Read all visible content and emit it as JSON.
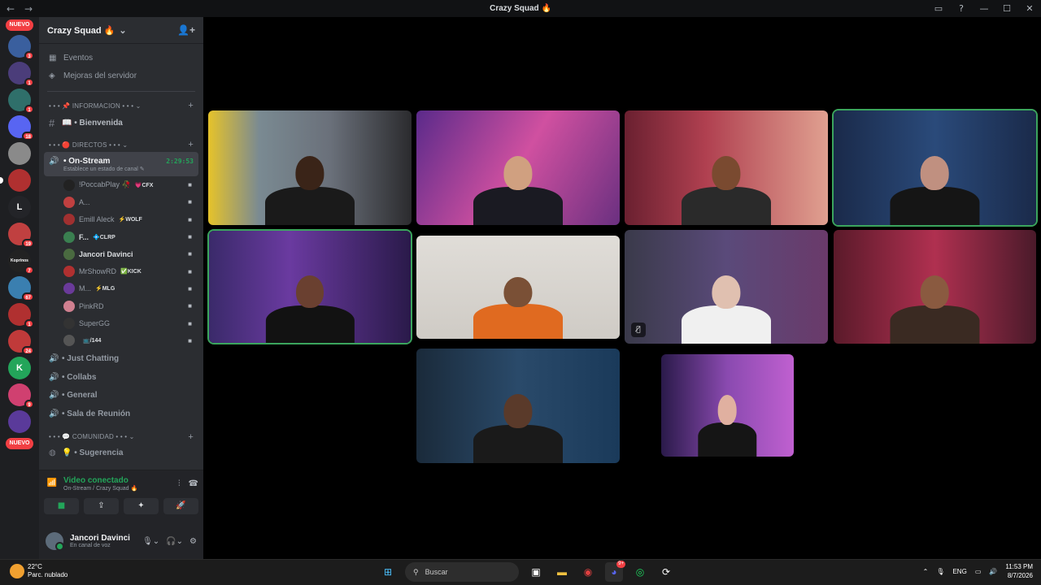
{
  "window": {
    "title": "Crazy Squad 🔥",
    "back": "←",
    "forward": "→",
    "inbox": "▭",
    "help": "?",
    "minimize": "—",
    "maximize": "☐",
    "close": "✕"
  },
  "guilds": {
    "new_label": "NUEVO",
    "items": [
      {
        "name": "guild-1",
        "badge": "3",
        "color": "#3a5f9e"
      },
      {
        "name": "guild-2",
        "badge": "1",
        "color": "#4b3d7a"
      },
      {
        "name": "guild-3",
        "badge": "1",
        "color": "#2f6f6a"
      },
      {
        "name": "guild-4",
        "badge": "18",
        "color": "#5865f2"
      },
      {
        "name": "guild-5",
        "badge": "",
        "color": "#8a8a8a"
      },
      {
        "name": "guild-6",
        "badge": "",
        "color": "#b03030"
      },
      {
        "name": "guild-7",
        "badge": "",
        "color": "#232428",
        "text": "L"
      },
      {
        "name": "guild-8",
        "badge": "19",
        "color": "#c04040"
      },
      {
        "name": "guild-9",
        "badge": "7",
        "color": "#222",
        "text": "Koprinos"
      },
      {
        "name": "guild-10",
        "badge": "67",
        "color": "#3a7fb0"
      },
      {
        "name": "guild-11",
        "badge": "1",
        "color": "#b03030"
      },
      {
        "name": "guild-12",
        "badge": "24",
        "color": "#c03a3a"
      },
      {
        "name": "guild-13",
        "badge": "",
        "color": "#23a55a",
        "text": "K"
      },
      {
        "name": "guild-14",
        "badge": "9",
        "color": "#d04070"
      },
      {
        "name": "guild-15",
        "badge": "",
        "color": "#5a3a9a"
      }
    ]
  },
  "server": {
    "name": "Crazy Squad 🔥",
    "events": "Eventos",
    "boosts": "Mejoras del servidor",
    "cat_info": "• • • 📌 INFORMACION • • • ⌄",
    "welcome": "📖 • Bienvenida",
    "cat_direct": "• • • 🔴 DIRECTOS • • • ⌄",
    "active_channel": "• On-Stream",
    "active_time": "2:29:53",
    "active_status": "Establece un estado de canal ✎",
    "users": [
      {
        "name": "!PoccabPlay 🥀",
        "tag": "💗CFX",
        "color": "#222",
        "bright": false
      },
      {
        "name": "A...",
        "tag": "",
        "color": "#c04040",
        "bright": false
      },
      {
        "name": "Emill Aleck",
        "tag": "⚡WOLF",
        "color": "#a03030",
        "bright": false
      },
      {
        "name": "F...",
        "tag": "💠CLRP",
        "color": "#3a7f50",
        "bright": true
      },
      {
        "name": "Jancori Davinci",
        "tag": "",
        "color": "#4a6a40",
        "bright": true
      },
      {
        "name": "MrShowRD",
        "tag": "✅KICK",
        "color": "#b03030",
        "bright": false
      },
      {
        "name": "M...",
        "tag": "⚡MLG",
        "color": "#6a3a9a",
        "bright": false
      },
      {
        "name": "PinkRD",
        "tag": "",
        "color": "#d08090",
        "bright": false
      },
      {
        "name": "SuperGG",
        "tag": "",
        "color": "#333",
        "bright": false
      },
      {
        "name": "",
        "tag": "📺/144",
        "color": "#555",
        "bright": false
      }
    ],
    "voice_channels": [
      "• Just Chatting",
      "• Collabs",
      "• General",
      "• Sala de Reunión"
    ],
    "cat_community": "• • • 💬 COMUNIDAD • • • ⌄",
    "suggestion": "💡 • Sugerencia"
  },
  "voice_panel": {
    "status": "Video conectado",
    "location": "On-Stream / Crazy Squad 🔥",
    "buttons": [
      "■",
      "⇪",
      "✦",
      "🚀"
    ]
  },
  "user": {
    "name": "Jancori Davinci",
    "status": "En canal de voz"
  },
  "stage": {
    "tiles": [
      {
        "bg": "linear-gradient(90deg,#e6c32a 0%,#7a8a92 25%,#6a707a 60%,#2b2b2e 100%)",
        "head": "#3a2418",
        "body": "#1a1a1a",
        "speaking": false,
        "muted": false
      },
      {
        "bg": "linear-gradient(120deg,#5a2a8a 0%,#d050a0 50%,#6a3080 100%)",
        "head": "#d0a080",
        "body": "#1a1a22",
        "speaking": false,
        "muted": false
      },
      {
        "bg": "linear-gradient(90deg,#6a2030 0%,#b04050 40%,#e0a090 100%)",
        "head": "#7a4a30",
        "body": "#2a2a2a",
        "speaking": false,
        "muted": false
      },
      {
        "bg": "linear-gradient(90deg,#1a2a4a 0%,#2a4a7a 50%,#1a2a4a 100%)",
        "head": "#c09080",
        "body": "#151515",
        "speaking": true,
        "muted": false
      },
      {
        "bg": "linear-gradient(90deg,#3a2a6a 0%,#6a3aa0 40%,#2a1a4a 100%)",
        "head": "#6a4030",
        "body": "#121212",
        "speaking": true,
        "muted": false
      },
      {
        "bg": "linear-gradient(180deg,#e0ddd8 0%,#cfcbc5 100%)",
        "head": "#7a5036",
        "body": "#e06a20",
        "speaking": false,
        "muted": false
      },
      {
        "bg": "linear-gradient(90deg,#3a3a4a 0%,#5a4a7a 50%,#6a3a6a 100%)",
        "head": "#e0c0b0",
        "body": "#f0f0f0",
        "speaking": false,
        "muted": true
      },
      {
        "bg": "linear-gradient(90deg,#5a1a2a 0%,#b03050 50%,#4a1a2a 100%)",
        "head": "#8a5a40",
        "body": "#3a2a22",
        "speaking": false,
        "muted": false
      },
      {
        "bg": "linear-gradient(90deg,#1a2a3a 0%,#2a4a6a 50%,#1a3a5a 100%)",
        "head": "#5a3a2a",
        "body": "#1a1a1a",
        "speaking": false,
        "muted": false
      },
      {
        "bg": "linear-gradient(90deg,#2a1a4a 0%,#8a4ab0 50%,#c060d0 100%)",
        "head": "#e0b0a0",
        "body": "#151515",
        "speaking": false,
        "muted": false
      }
    ]
  },
  "taskbar": {
    "temp": "22°C",
    "weather": "Parc. nublado",
    "search": "Buscar",
    "lang": "ENG",
    "time": "11:53 PM",
    "date": "8/7/2026",
    "discord_badge": "9+"
  }
}
